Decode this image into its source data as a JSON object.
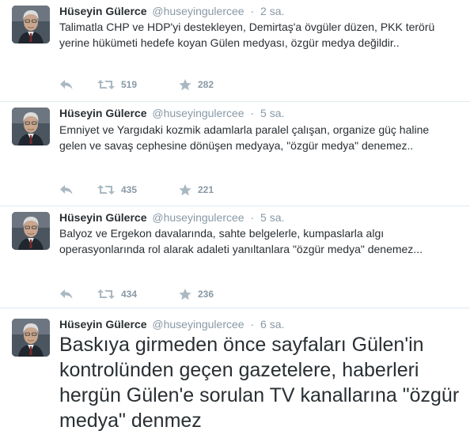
{
  "tweets": [
    {
      "fullname": "Hüseyin Gülerce",
      "username": "@huseyingulercee",
      "separator": "·",
      "time": "2 sa.",
      "text": "Talimatla CHP ve HDP'yi destekleyen, Demirtaş'a övgüler düzen, PKK terörü yerine hükümeti hedefe koyan Gülen medyası, özgür medya değildir..",
      "retweets": "519",
      "favorites": "282"
    },
    {
      "fullname": "Hüseyin Gülerce",
      "username": "@huseyingulercee",
      "separator": "·",
      "time": "5 sa.",
      "text": "Emniyet ve Yargıdaki kozmik adamlarla paralel çalışan, organize güç haline gelen ve savaş cephesine dönüşen medyaya, \"özgür medya\" denemez..",
      "retweets": "435",
      "favorites": "221"
    },
    {
      "fullname": "Hüseyin Gülerce",
      "username": "@huseyingulercee",
      "separator": "·",
      "time": "5 sa.",
      "text": "Balyoz ve Ergekon davalarında, sahte belgelerle, kumpaslarla algı operasyonlarında rol alarak adaleti yanıltanlara \"özgür medya\" denemez...",
      "retweets": "434",
      "favorites": "236"
    },
    {
      "fullname": "Hüseyin Gülerce",
      "username": "@huseyingulercee",
      "separator": "·",
      "time": "6 sa.",
      "text": "Baskıya girmeden önce sayfaları Gülen'in kontrolünden geçen gazetelere, haberleri hergün Gülen'e sorulan TV kanallarına \"özgür medya\" denmez"
    }
  ],
  "icons": {
    "reply": "reply-icon",
    "retweet": "retweet-icon",
    "favorite": "star-icon"
  },
  "colors": {
    "name": "#292f33",
    "meta": "#8899a6",
    "icon": "#aab8c2",
    "divider": "#e1e8ed"
  }
}
